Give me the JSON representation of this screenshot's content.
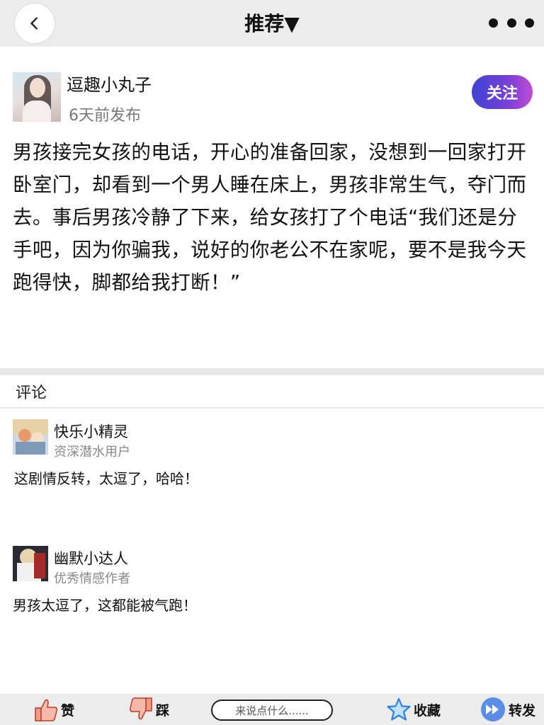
{
  "header": {
    "title": "推荐▼"
  },
  "post": {
    "author_name": "逗趣小丸子",
    "time": "6天前发布",
    "follow_label": "关注",
    "text": "男孩接完女孩的电话，开心的准备回家，没想到一回家打开卧室门，却看到一个男人睡在床上，男孩非常生气，夺门而去。事后男孩冷静了下来，给女孩打了个电话“我们还是分手吧，因为你骗我，说好的你老公不在家呢，要不是我今天跑得快，脚都给我打断！”"
  },
  "comments": {
    "header": "评论",
    "items": [
      {
        "name": "快乐小精灵",
        "badge": "资深潜水用户",
        "text": "这剧情反转，太逗了，哈哈！"
      },
      {
        "name": "幽默小达人",
        "badge": "优秀情感作者",
        "text": "男孩太逗了，这都能被气跑！"
      }
    ]
  },
  "bottom_bar": {
    "like_label": "赞",
    "dislike_label": "踩",
    "input_placeholder": "来说点什么......",
    "favorite_label": "收藏",
    "share_label": "转发"
  },
  "colors": {
    "follow_gradient_start": "#3d44d6",
    "follow_gradient_end": "#c24bd6",
    "like_icon": "#f39a86",
    "star_icon": "#2f7fe8",
    "share_icon": "#5a8de8"
  },
  "icons": [
    "chevron-left-icon",
    "more-dots-icon",
    "thumbs-up-icon",
    "thumbs-down-icon",
    "star-icon",
    "forward-icon"
  ]
}
